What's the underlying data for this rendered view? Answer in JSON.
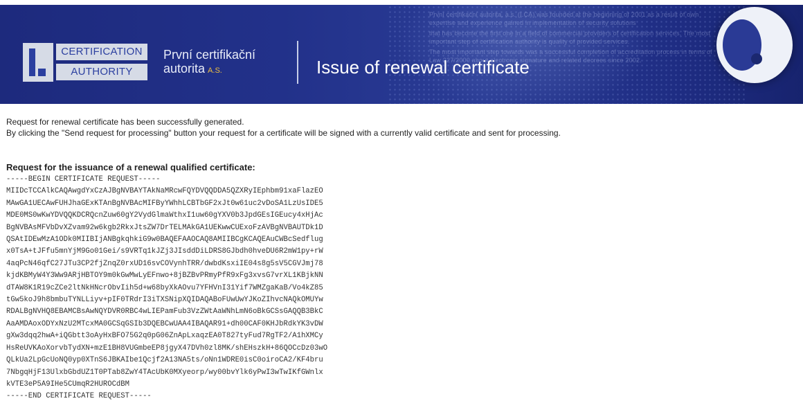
{
  "header": {
    "logo": {
      "line1": "CERTIFICATION",
      "line2": "AUTHORITY"
    },
    "company": {
      "name": "První certifikační",
      "name2": "autorita",
      "suffix": "A.S."
    },
    "page_title": "Issue of renewal certificate",
    "background_text": [
      "První certifikační autorita, a.s. (I.CA) was founded at the beginning of 2001 as a result of own expertise and experience gained in implementation of security solutions",
      "that has become the first one in a field of commercial providers of certification services. The most important step of certification authority is quality of provided services.",
      "The most important step towards was a successful completion of accreditation process in terms of Law 227/2000 about electronic signature and related decrees since 2002."
    ]
  },
  "content": {
    "line1": "Request for renewal certificate has been successfully generated.",
    "line2": "By clicking the \"Send request for processing\" button your request for a certificate will be signed with a currently valid certificate and sent for processing.",
    "request_heading": "Request for the issuance of a renewal qualified certificate:",
    "pem_lines": [
      "-----BEGIN CERTIFICATE REQUEST-----",
      "MIIDcTCCAlkCAQAwgdYxCzAJBgNVBAYTAkNaMRcwFQYDVQQDDA5QZXRyIEphbm91xaFlazEO",
      "MAwGA1UECAwFUHJhaGExKTAnBgNVBAcMIFByYWhhLCBTbGF2xJt0w61uc2vDoSA1LzUsIDE5",
      "MDE0MS0wKwYDVQQKDCRQcnZuw60gY2VydGlmaWthxI1uw60gYXV0b3JpdGEsIGEucy4xHjAc",
      "BgNVBAsMFVbDvXZvam92w6kgb2RkxJtsZW7DrTELMAkGA1UEKwwCUExoFzAVBgNVBAUTDk1D",
      "QSAtIDEwMzA1ODk0MIIBIjANBgkqhkiG9w0BAQEFAAOCAQ8AMIIBCgKCAQEAuCWBcSedflug",
      "x0TsA+tJFfu5mnYjM9Go01Gei/s9VRTq1kJZj3JIsddDiLDRS8GJbdh0hveDU6R2mW1py+rW",
      "4aqPcN46qfC27JTu3CP2fjZnqZ0rxUD16svCOVynhTRR/dwbdKsxiIE04s8g5sV5CGVJmj78",
      "kjdKBMyW4Y3Ww9ARjHBTOY9m0kGwMwLyEFnwo+8jBZBvPRmyPfR9xFg3xvsG7vrXL1KBjkNN",
      "dTAW8K1R19cZCe2ltNkHNcrObvIih5d+w68byXkAOvu7YFHVnI31Yif7WMZgaKaB/Vo4kZ85",
      "tGw5koJ9h8bmbuTYNLLiyv+pIF0TRdrI3iTXSNipXQIDAQABoFUwUwYJKoZIhvcNAQkOMUYw",
      "RDALBgNVHQ8EBAMCBsAwNQYDVR0RBC4wLIEPamFub3VzZWtAaWNhLmN6oBkGCSsGAQQB3BkC",
      "AaAMDAoxODYxNzU2MTcxMA0GCSqGSIb3DQEBCwUAA4IBAQAR91+dh00CAF0KHJbRdkYK3vDW",
      "gXw3dqq2hwA+iQGbtt3oAyHxBFO75G2q0pG06ZnApLxaqzEA0T827tyFud7RgTF2/A1hXMCy",
      "HsReUVKAoXorvbTydXN+mzE1BH8VUGmbeEP8jgyX47DVh0zl8MK/shEHszkH+86QOCcDz03wO",
      "QLkUa2LpGcUoNQ0yp0XTnS6JBKAIbe1Qcjf2A13NA5ts/oNn1WDRE0isC0oiroCA2/KF4bru",
      "7NbgqHjF13UlxbGbdUZ1T0PTab8ZwY4TAcUbK0MXyeorp/wy00bvYlk6yPwI3wTwIKfGWnlx",
      "kVTE3eP5A9IHe5CUmqR2HUROCdBM",
      "-----END CERTIFICATE REQUEST-----"
    ]
  },
  "colors": {
    "banner": "#22318a",
    "logo_blue": "#2b3fa0",
    "logo_bg": "#d6dbe6",
    "accent_gold": "#f0c040"
  }
}
